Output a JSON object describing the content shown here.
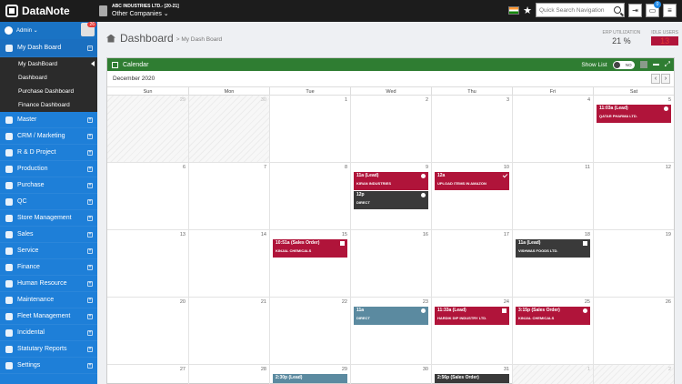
{
  "topbar": {
    "logo_text": "DataNote",
    "company_line1": "ABC INDUSTRIES LTD.- [20-21]",
    "company_line2": "Other Companies ⌄",
    "search_placeholder": "Quick Search Navigation",
    "notification_count": "0",
    "icons": [
      "flag-icon",
      "star-icon",
      "search-icon",
      "logout-icon",
      "chat-icon",
      "menu-icon"
    ]
  },
  "sidebar": {
    "user": "Admin ⌄",
    "avatar_badge": "26",
    "items": [
      {
        "label": "My Dash Board",
        "icon": "dashboard-icon",
        "active": true
      },
      {
        "label": "Master",
        "icon": "gear-icon"
      },
      {
        "label": "CRM / Marketing",
        "icon": "chat-icon"
      },
      {
        "label": "R & D Project",
        "icon": "link-icon"
      },
      {
        "label": "Production",
        "icon": "factory-icon"
      },
      {
        "label": "Purchase",
        "icon": "cart-icon"
      },
      {
        "label": "QC",
        "icon": "check-icon"
      },
      {
        "label": "Store Management",
        "icon": "exchange-icon"
      },
      {
        "label": "Sales",
        "icon": "truck-icon"
      },
      {
        "label": "Service",
        "icon": "headset-icon"
      },
      {
        "label": "Finance",
        "icon": "dollar-icon"
      },
      {
        "label": "Human Resource",
        "icon": "users-icon"
      },
      {
        "label": "Maintenance",
        "icon": "wrench-icon"
      },
      {
        "label": "Fleet Management",
        "icon": "bus-icon"
      },
      {
        "label": "Incidental",
        "icon": "file-icon"
      },
      {
        "label": "Statutary Reports",
        "icon": "chart-icon"
      },
      {
        "label": "Settings",
        "icon": "cog-icon"
      }
    ],
    "subitems": [
      "My DashBoard",
      "Dashboard",
      "Purchase Dashboard",
      "Finance Dashboard"
    ]
  },
  "header": {
    "title": "Dashboard",
    "breadcrumb": "> My Dash Board",
    "erp_label": "ERP UTILIZATION",
    "erp_value": "21 %",
    "idle_label": "IDLE USERS",
    "idle_value": "13"
  },
  "calendar": {
    "title": "Calendar",
    "show_list": "Show List",
    "toggle": "NO",
    "month": "December 2020",
    "days": [
      "Sun",
      "Mon",
      "Tue",
      "Wed",
      "Thu",
      "Fri",
      "Sat"
    ],
    "cells": [
      {
        "d": "29",
        "other": true
      },
      {
        "d": "30",
        "other": true
      },
      {
        "d": "1"
      },
      {
        "d": "2"
      },
      {
        "d": "3"
      },
      {
        "d": "4"
      },
      {
        "d": "5",
        "events": [
          {
            "t1": "11:03a (Lead)",
            "t2": "QATAR PHARMA LTD.",
            "color": "red",
            "icon": "person-icon"
          }
        ]
      },
      {
        "d": "6"
      },
      {
        "d": "7"
      },
      {
        "d": "8"
      },
      {
        "d": "9",
        "events": [
          {
            "t1": "11a (Lead)",
            "t2": "KIRAN INDUSTRIES",
            "color": "red",
            "icon": "person-icon"
          },
          {
            "t1": "12p",
            "t2": "Direct",
            "color": "dark",
            "icon": "clock-icon"
          }
        ]
      },
      {
        "d": "10",
        "events": [
          {
            "t1": "12a",
            "t2": "UPLOAD ITEMS IN AMAZON",
            "color": "red",
            "icon": "check-icon"
          }
        ]
      },
      {
        "d": "11"
      },
      {
        "d": "12"
      },
      {
        "d": "13"
      },
      {
        "d": "14"
      },
      {
        "d": "15",
        "events": [
          {
            "t1": "10:51a (Sales Order)",
            "t2": "KINJAL CHEMICALS",
            "color": "red",
            "icon": "mail-icon"
          }
        ]
      },
      {
        "d": "16"
      },
      {
        "d": "17"
      },
      {
        "d": "18",
        "events": [
          {
            "t1": "11a (Lead)",
            "t2": "VISHWAS FOODS LTD.",
            "color": "dark",
            "icon": "phone-icon"
          }
        ]
      },
      {
        "d": "19"
      },
      {
        "d": "20"
      },
      {
        "d": "21"
      },
      {
        "d": "22"
      },
      {
        "d": "23",
        "events": [
          {
            "t1": "11a",
            "t2": "Direct",
            "color": "steel",
            "icon": "clock-icon"
          }
        ]
      },
      {
        "d": "24",
        "events": [
          {
            "t1": "11:33a (Lead)",
            "t2": "HARDIK DIP INDUSTRY LTD.",
            "color": "red",
            "icon": "mail-icon"
          }
        ]
      },
      {
        "d": "25",
        "events": [
          {
            "t1": "3:15p (Sales Order)",
            "t2": "KINJAL CHEMICALS",
            "color": "red",
            "icon": "person-icon"
          }
        ]
      },
      {
        "d": "26"
      },
      {
        "d": "27"
      },
      {
        "d": "28"
      },
      {
        "d": "29",
        "events": [
          {
            "t1": "2:30p (Lead)",
            "t2": "",
            "color": "steel",
            "icon": ""
          }
        ]
      },
      {
        "d": "30"
      },
      {
        "d": "31",
        "events": [
          {
            "t1": "2:56p (Sales Order)",
            "t2": "",
            "color": "dark",
            "icon": ""
          }
        ]
      },
      {
        "d": "1",
        "other": true
      },
      {
        "d": "2",
        "other": true
      }
    ]
  }
}
